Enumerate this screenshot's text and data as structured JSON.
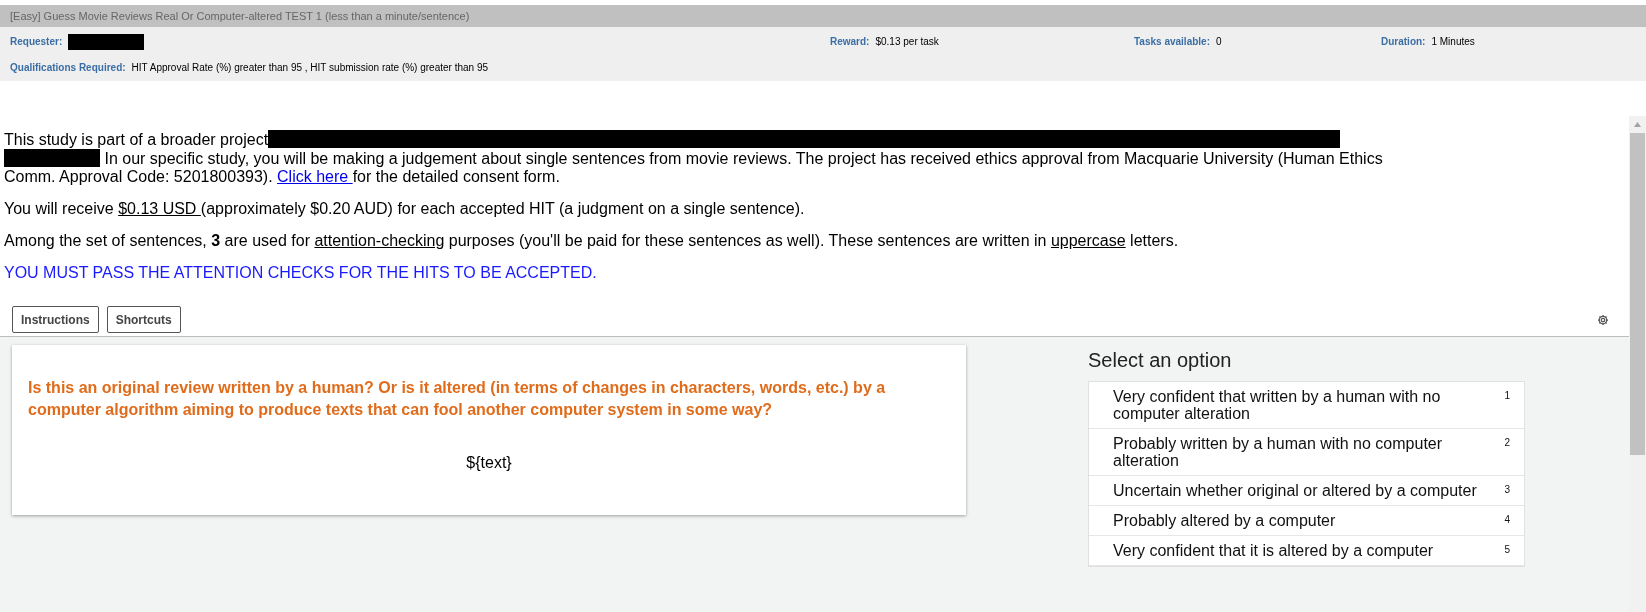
{
  "hit_header": {
    "title": "[Easy] Guess Movie Reviews Real Or Computer-altered TEST 1 (less than a minute/sentence)",
    "fields": [
      {
        "label": "Requester:"
      },
      {
        "label": "Reward:",
        "value": "$0.13 per task"
      },
      {
        "label": "Tasks available:",
        "value": "0"
      },
      {
        "label": "Duration:",
        "value": "1 Minutes"
      }
    ],
    "qualifications": {
      "label": "Qualifications Required:",
      "value": "HIT Approval Rate (%) greater than 95 , HIT submission rate (%) greater than 95"
    }
  },
  "intro": [
    [
      {
        "kind": "plain",
        "text": "This study is part of a broader project"
      },
      {
        "kind": "redacted"
      },
      {
        "kind": "break"
      },
      {
        "kind": "redacted"
      },
      {
        "kind": "plain",
        "text": " In our specific study, you will be making a judgement about single sentences from movie reviews. The project has received ethics approval from Macquarie University (Human Ethics Comm. Approval Code: 5201800393). "
      },
      {
        "kind": "link",
        "text": "Click here "
      },
      {
        "kind": "plain",
        "text": "for the detailed consent form."
      }
    ],
    [
      {
        "kind": "plain",
        "text": "You will receive "
      },
      {
        "kind": "underline",
        "text": "$0.13 USD "
      },
      {
        "kind": "plain",
        "text": "(approximately $0.20 AUD) for each accepted HIT (a judgment on a single sentence)."
      }
    ],
    [
      {
        "kind": "plain",
        "text": "Among the set of sentences, "
      },
      {
        "kind": "bold",
        "text": "3"
      },
      {
        "kind": "plain",
        "text": " are used for "
      },
      {
        "kind": "underline",
        "text": "attention-checking"
      },
      {
        "kind": "plain",
        "text": " purposes (you'll be paid for these sentences as well). These sentences are written in "
      },
      {
        "kind": "underline",
        "text": "uppercase"
      },
      {
        "kind": "plain",
        "text": " letters."
      }
    ],
    [
      {
        "kind": "notice",
        "text": "YOU MUST PASS THE ATTENTION CHECKS FOR THE HITS TO BE ACCEPTED."
      }
    ]
  ],
  "toolbar": {
    "buttons": [
      "Instructions",
      "Shortcuts"
    ]
  },
  "question": {
    "prompt": "Is this an original review written by a human? Or is it altered (in terms of changes in characters, words, etc.) by a computer algorithm aiming to produce texts that can fool another computer system in some way?",
    "text": "${text}"
  },
  "options": {
    "title": "Select an option",
    "items": [
      {
        "label": "Very confident that written by a human with no computer alteration",
        "shortcut": "1",
        "selected": false
      },
      {
        "label": "Probably written by a human with no computer alteration",
        "shortcut": "2",
        "selected": false
      },
      {
        "label": "Uncertain whether original or altered by a computer",
        "shortcut": "3",
        "selected": false
      },
      {
        "label": "Probably altered by a computer",
        "shortcut": "4",
        "selected": false
      },
      {
        "label": "Very confident that it is altered by a computer",
        "shortcut": "5",
        "selected": false
      }
    ]
  }
}
